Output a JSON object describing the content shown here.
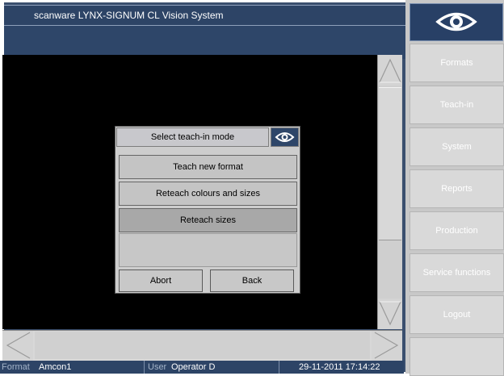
{
  "app": {
    "title": "scanware LYNX-SIGNUM CL Vision System"
  },
  "sidebar": {
    "logo_icon": "eye-icon",
    "items": [
      {
        "label": "Formats"
      },
      {
        "label": "Teach-in"
      },
      {
        "label": "System"
      },
      {
        "label": "Reports"
      },
      {
        "label": "Production"
      },
      {
        "label": "Service functions"
      },
      {
        "label": "Logout"
      }
    ]
  },
  "dialog": {
    "title": "Select teach-in mode",
    "icon": "eye-icon",
    "options": [
      {
        "label": "Teach new format"
      },
      {
        "label": "Reteach colours and sizes"
      },
      {
        "label": "Reteach sizes"
      }
    ],
    "abort_label": "Abort",
    "back_label": "Back"
  },
  "status": {
    "format_key": "Format",
    "format_value": "Amcon1",
    "user_key": "User",
    "user_value": "Operator D",
    "datetime": "29-11-2011 17:14:22"
  },
  "colors": {
    "title_bar": "#2d4466",
    "viewport": "#000000",
    "panel": "#c8c8c8"
  }
}
